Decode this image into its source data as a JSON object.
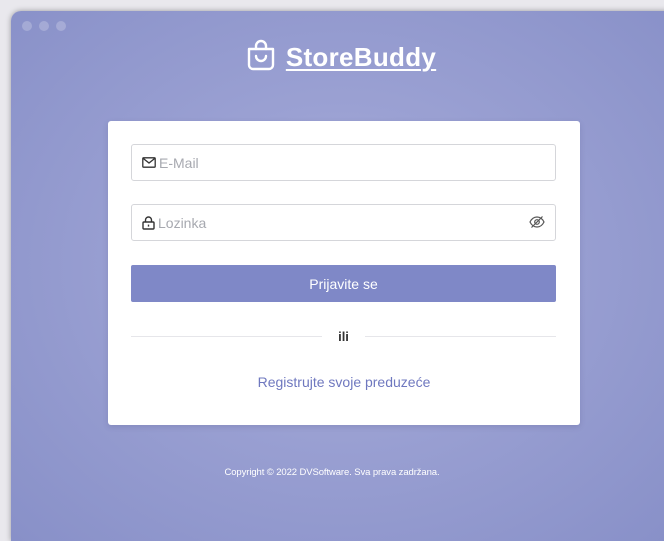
{
  "app": {
    "brand": "StoreBuddy"
  },
  "login": {
    "email_placeholder": "E-Mail",
    "password_placeholder": "Lozinka",
    "submit_label": "Prijavite se",
    "divider_text": "ili",
    "register_link": "Registrujte svoje preduzeće"
  },
  "footer": {
    "copyright": "Copyright © 2022 DVSoftware. Sva prava zadržana."
  },
  "icons": {
    "logo": "shopping-bag-icon",
    "email": "envelope-icon",
    "password": "lock-icon",
    "toggle": "eye-off-icon"
  },
  "colors": {
    "background": "#9ba1d3",
    "accent": "#7f88c7",
    "link": "#6f78bf",
    "card": "#ffffff"
  }
}
